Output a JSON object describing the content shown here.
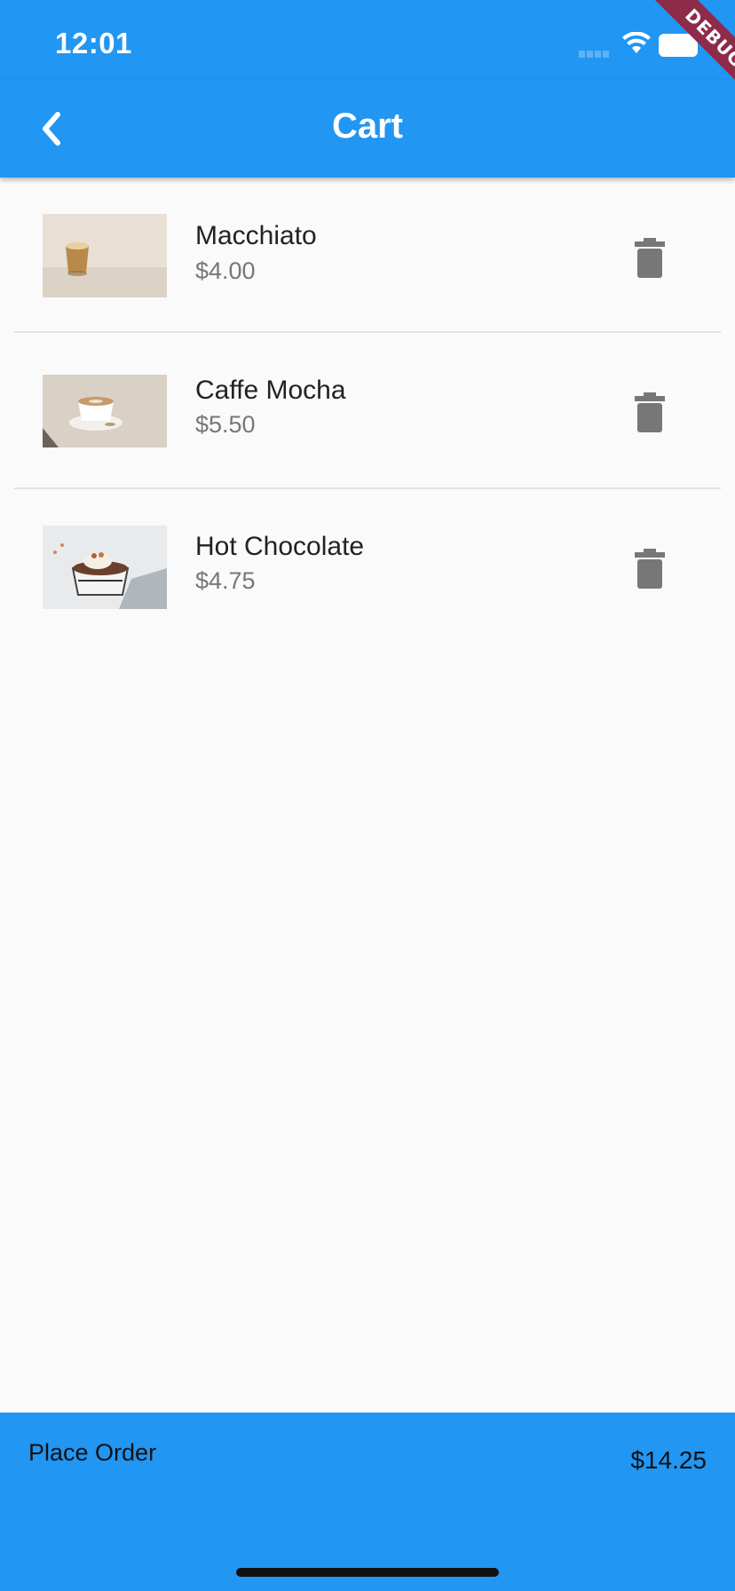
{
  "status_bar": {
    "time": "12:01"
  },
  "debug_banner": "DEBUG",
  "app_bar": {
    "title": "Cart"
  },
  "cart": {
    "items": [
      {
        "name": "Macchiato",
        "price": "$4.00",
        "image": "macchiato-photo"
      },
      {
        "name": "Caffe Mocha",
        "price": "$5.50",
        "image": "caffe-mocha-photo"
      },
      {
        "name": "Hot Chocolate",
        "price": "$4.75",
        "image": "hot-chocolate-photo"
      }
    ]
  },
  "footer": {
    "place_order_label": "Place Order",
    "total": "$14.25"
  },
  "icons": {
    "back": "chevron-left-icon",
    "delete": "trash-icon"
  },
  "colors": {
    "primary": "#2196f3",
    "background": "#fafafa",
    "debug_ribbon": "#8e2b4a"
  }
}
